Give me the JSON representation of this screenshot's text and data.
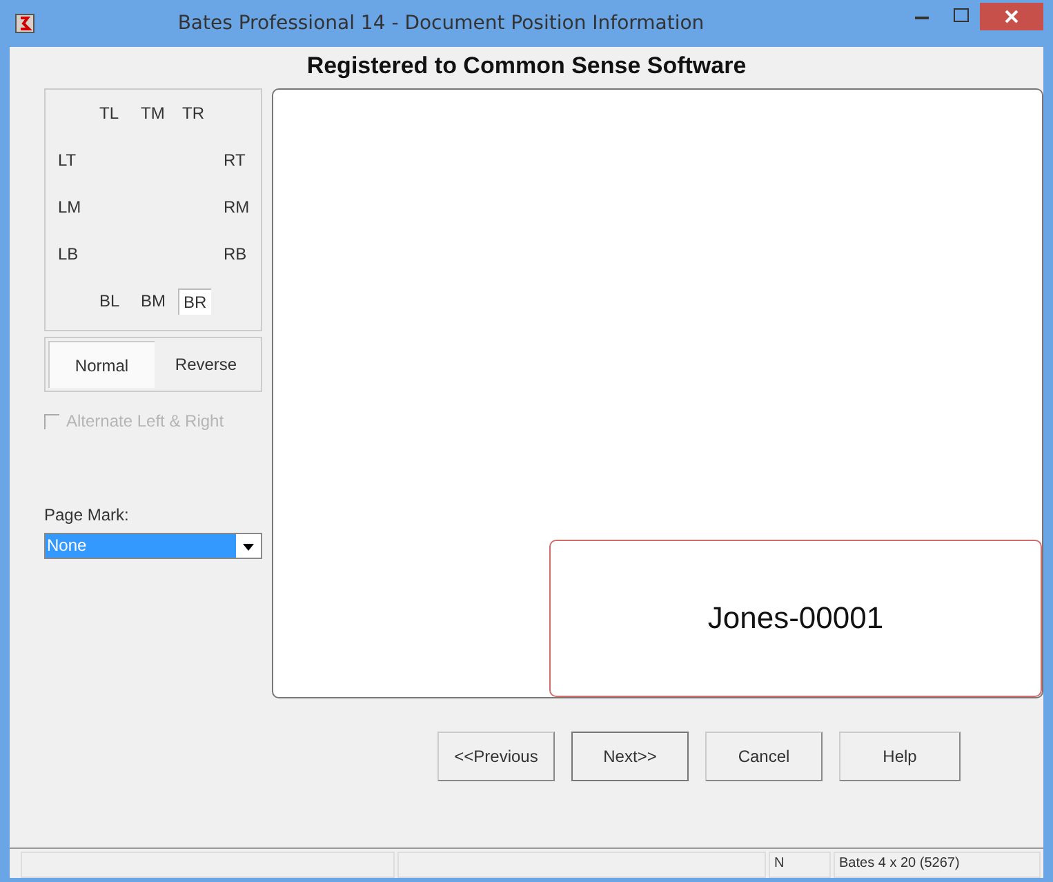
{
  "window": {
    "title": "Bates Professional 14 - Document Position Information"
  },
  "heading": "Registered to Common Sense Software",
  "position_grid": {
    "top": [
      {
        "label": "TL",
        "selected": false
      },
      {
        "label": "TM",
        "selected": false
      },
      {
        "label": "TR",
        "selected": false
      }
    ],
    "sides": [
      {
        "left": {
          "label": "LT",
          "selected": false
        },
        "right": {
          "label": "RT",
          "selected": false
        }
      },
      {
        "left": {
          "label": "LM",
          "selected": false
        },
        "right": {
          "label": "RM",
          "selected": false
        }
      },
      {
        "left": {
          "label": "LB",
          "selected": false
        },
        "right": {
          "label": "RB",
          "selected": false
        }
      }
    ],
    "bottom": [
      {
        "label": "BL",
        "selected": false
      },
      {
        "label": "BM",
        "selected": false
      },
      {
        "label": "BR",
        "selected": true
      }
    ]
  },
  "order_toggle": [
    {
      "label": "Normal",
      "selected": true
    },
    {
      "label": "Reverse",
      "selected": false
    }
  ],
  "alternate_checkbox": {
    "label": "Alternate Left & Right",
    "checked": false,
    "disabled": true
  },
  "page_mark": {
    "label": "Page Mark:",
    "value": "None"
  },
  "preview": {
    "stamp": "Jones-00001"
  },
  "buttons": [
    "<<Previous",
    "Next>>",
    "Cancel",
    "Help"
  ],
  "status_bar": [
    "N",
    "Bates 4 x 20 (5267)"
  ]
}
